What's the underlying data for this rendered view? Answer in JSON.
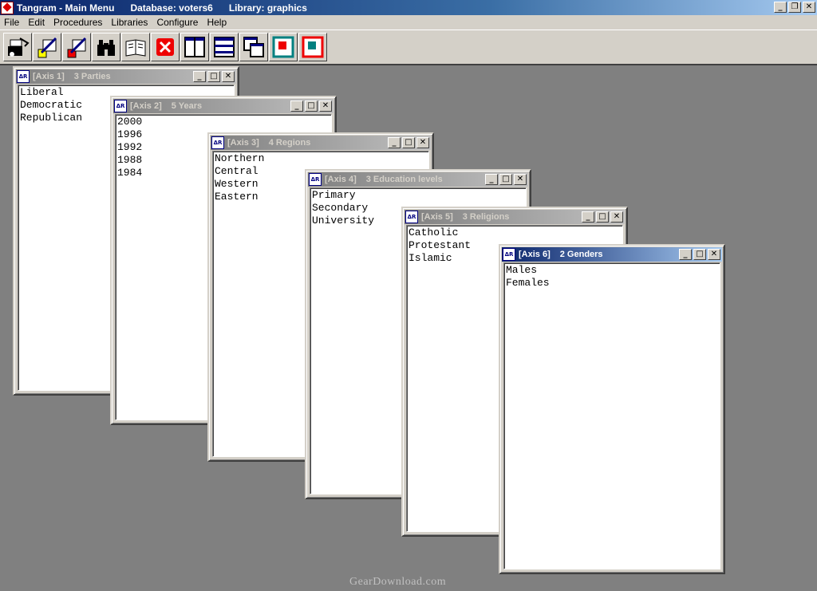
{
  "app": {
    "title_main": "Tangram - Main Menu",
    "title_db": "Database: voters6",
    "title_lib": "Library: graphics",
    "controls": [
      "_",
      "❐",
      "✕"
    ]
  },
  "menu": [
    "File",
    "Edit",
    "Procedures",
    "Libraries",
    "Configure",
    "Help"
  ],
  "toolbar": {
    "buttons": [
      "open-icon",
      "edit-yellow-icon",
      "edit-red-icon",
      "binoculars-icon",
      "book-icon",
      "close-red-icon",
      "layout-columns-icon",
      "layout-rows-icon",
      "layout-cascade-icon",
      "red-square-icon",
      "teal-square-icon"
    ]
  },
  "axes": [
    {
      "name": "[Axis 1]",
      "desc": "3 Parties",
      "items": [
        "Liberal",
        "Democratic",
        "Republican"
      ]
    },
    {
      "name": "[Axis 2]",
      "desc": "5 Years",
      "items": [
        "2000",
        "1996",
        "1992",
        "1988",
        "1984"
      ]
    },
    {
      "name": "[Axis 3]",
      "desc": "4 Regions",
      "items": [
        "Northern",
        "Central",
        "Western",
        "Eastern"
      ]
    },
    {
      "name": "[Axis 4]",
      "desc": "3 Education levels",
      "items": [
        "Primary",
        "Secondary",
        "University"
      ]
    },
    {
      "name": "[Axis 5]",
      "desc": "3 Religions",
      "items": [
        "Catholic",
        "Protestant",
        "Islamic"
      ]
    },
    {
      "name": "[Axis 6]",
      "desc": "2 Genders",
      "items": [
        "Males",
        "Females"
      ]
    }
  ],
  "axis_icon_text": "ΔR",
  "watermark": "GearDownload.com"
}
